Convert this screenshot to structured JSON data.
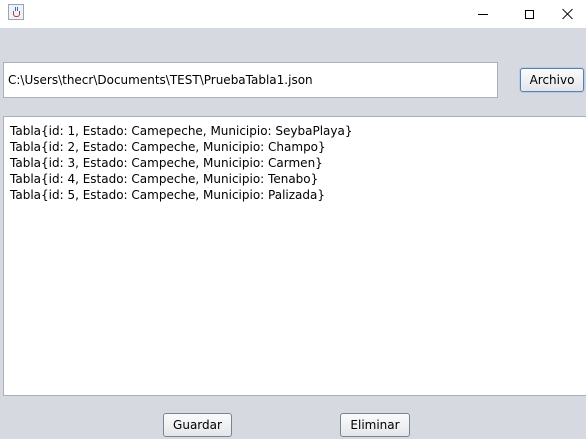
{
  "window": {
    "controls": {
      "minimize": "minimize-icon",
      "maximize": "maximize-icon",
      "close": "close-icon"
    }
  },
  "file_path": {
    "value": "C:\\Users\\thecr\\Documents\\TEST\\PruebaTabla1.json"
  },
  "buttons": {
    "archivo": "Archivo",
    "guardar": "Guardar",
    "eliminar": "Eliminar"
  },
  "records": [
    "Tabla{id: 1, Estado: Camepeche, Municipio: SeybaPlaya}",
    "Tabla{id: 2, Estado: Campeche, Municipio: Champo}",
    "Tabla{id: 3, Estado: Campeche, Municipio: Carmen}",
    "Tabla{id: 4, Estado: Campeche, Municipio: Tenabo}",
    "Tabla{id: 5, Estado: Campeche, Municipio: Palizada}"
  ]
}
